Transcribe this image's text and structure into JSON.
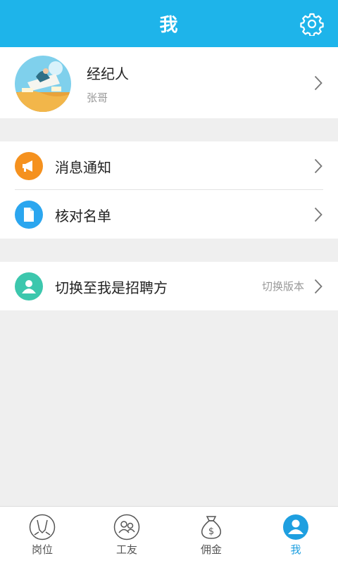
{
  "header": {
    "title": "我"
  },
  "profile": {
    "name": "经纪人",
    "subtitle": "张哥"
  },
  "menu": [
    {
      "label": "消息通知",
      "icon": "megaphone-icon",
      "color": "#f5911e"
    },
    {
      "label": "核对名单",
      "icon": "document-icon",
      "color": "#2ba6ef"
    }
  ],
  "switch_row": {
    "label": "切换至我是招聘方",
    "extra": "切换版本",
    "icon": "person-icon",
    "color": "#3cc7ad"
  },
  "tabs": [
    {
      "label": "岗位",
      "icon": "job-icon",
      "active": false
    },
    {
      "label": "工友",
      "icon": "workmates-icon",
      "active": false
    },
    {
      "label": "佣金",
      "icon": "money-bag-icon",
      "active": false
    },
    {
      "label": "我",
      "icon": "profile-icon",
      "active": true
    }
  ],
  "colors": {
    "header": "#1eb4ea",
    "active_tab": "#1e9fe0"
  }
}
